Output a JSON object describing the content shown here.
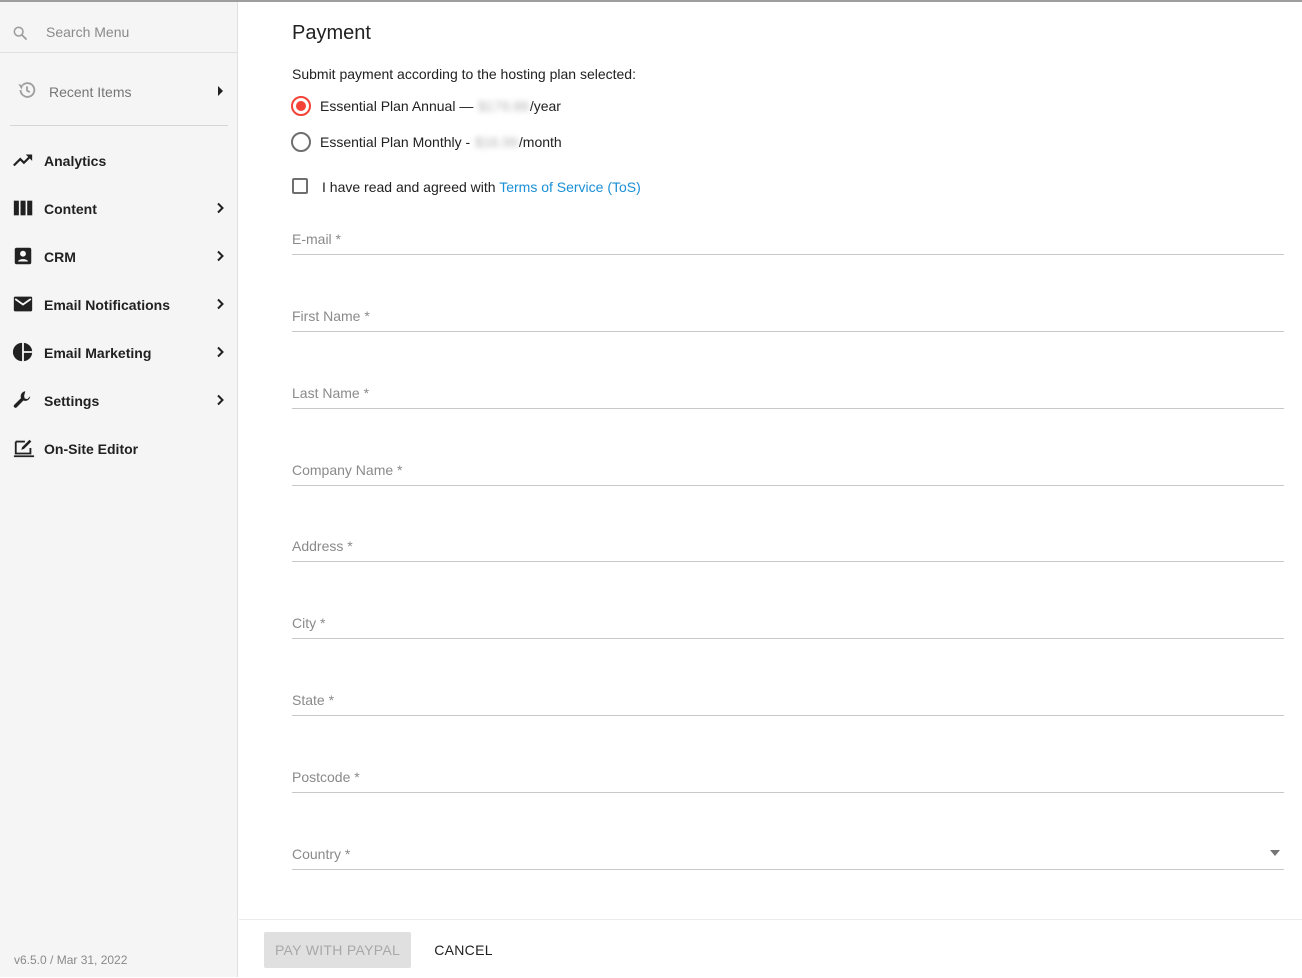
{
  "sidebar": {
    "search_placeholder": "Search Menu",
    "recent_label": "Recent Items",
    "items": [
      {
        "label": "Analytics",
        "icon": "trending-up-icon",
        "has_submenu": false
      },
      {
        "label": "Content",
        "icon": "columns-icon",
        "has_submenu": true
      },
      {
        "label": "CRM",
        "icon": "contact-icon",
        "has_submenu": true
      },
      {
        "label": "Email Notifications",
        "icon": "mail-icon",
        "has_submenu": true
      },
      {
        "label": "Email Marketing",
        "icon": "pie-chart-icon",
        "has_submenu": true
      },
      {
        "label": "Settings",
        "icon": "wrench-icon",
        "has_submenu": true
      },
      {
        "label": "On-Site Editor",
        "icon": "edit-screen-icon",
        "has_submenu": false
      }
    ],
    "version": "v6.5.0 / Mar 31, 2022"
  },
  "payment": {
    "title": "Payment",
    "intro": "Submit payment according to the hosting plan selected:",
    "plans": [
      {
        "prefix": "Essential Plan Annual — ",
        "price": "$179.88",
        "suffix": "/year",
        "selected": true
      },
      {
        "prefix": "Essential Plan Monthly - ",
        "price": "$16.99",
        "suffix": "/month",
        "selected": false
      }
    ],
    "tos_text": "I have read and agreed with ",
    "tos_link": "Terms of Service (ToS)",
    "fields": {
      "email": "E-mail *",
      "first_name": "First Name *",
      "last_name": "Last Name *",
      "company": "Company Name *",
      "address": "Address *",
      "city": "City *",
      "state": "State *",
      "postcode": "Postcode *",
      "country": "Country *"
    },
    "pay_label": "PAY WITH PAYPAL",
    "cancel_label": "CANCEL"
  },
  "colors": {
    "accent_radio": "#f44336",
    "link": "#1a8fd6"
  }
}
